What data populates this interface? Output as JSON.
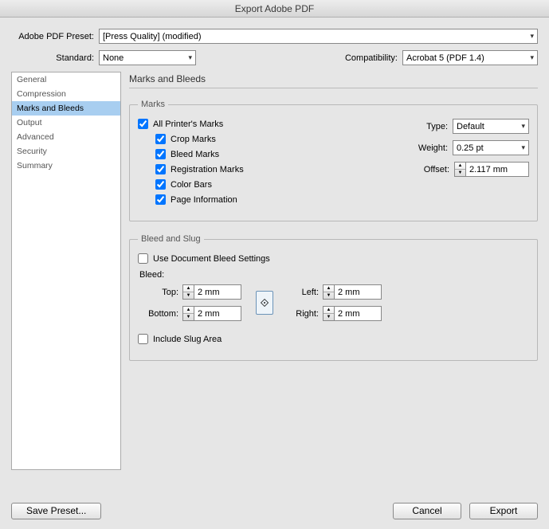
{
  "title": "Export Adobe PDF",
  "preset": {
    "label": "Adobe PDF Preset:",
    "value": "[Press Quality] (modified)"
  },
  "standard": {
    "label": "Standard:",
    "value": "None"
  },
  "compatibility": {
    "label": "Compatibility:",
    "value": "Acrobat 5 (PDF 1.4)"
  },
  "sidebar": {
    "items": [
      {
        "label": "General"
      },
      {
        "label": "Compression"
      },
      {
        "label": "Marks and Bleeds"
      },
      {
        "label": "Output"
      },
      {
        "label": "Advanced"
      },
      {
        "label": "Security"
      },
      {
        "label": "Summary"
      }
    ],
    "selectedIndex": 2
  },
  "panel": {
    "title": "Marks and Bleeds",
    "marks": {
      "legend": "Marks",
      "allPrinters": "All Printer's Marks",
      "crop": "Crop Marks",
      "bleed": "Bleed Marks",
      "registration": "Registration Marks",
      "colorBars": "Color Bars",
      "pageInfo": "Page Information",
      "typeLabel": "Type:",
      "typeValue": "Default",
      "weightLabel": "Weight:",
      "weightValue": "0.25 pt",
      "offsetLabel": "Offset:",
      "offsetValue": "2.117 mm"
    },
    "bleedSlug": {
      "legend": "Bleed and Slug",
      "useDoc": "Use Document Bleed Settings",
      "bleedHead": "Bleed:",
      "topLabel": "Top:",
      "topValue": "2 mm",
      "bottomLabel": "Bottom:",
      "bottomValue": "2 mm",
      "leftLabel": "Left:",
      "leftValue": "2 mm",
      "rightLabel": "Right:",
      "rightValue": "2 mm",
      "includeSlug": "Include Slug Area"
    }
  },
  "buttons": {
    "savePreset": "Save Preset...",
    "cancel": "Cancel",
    "export": "Export"
  }
}
